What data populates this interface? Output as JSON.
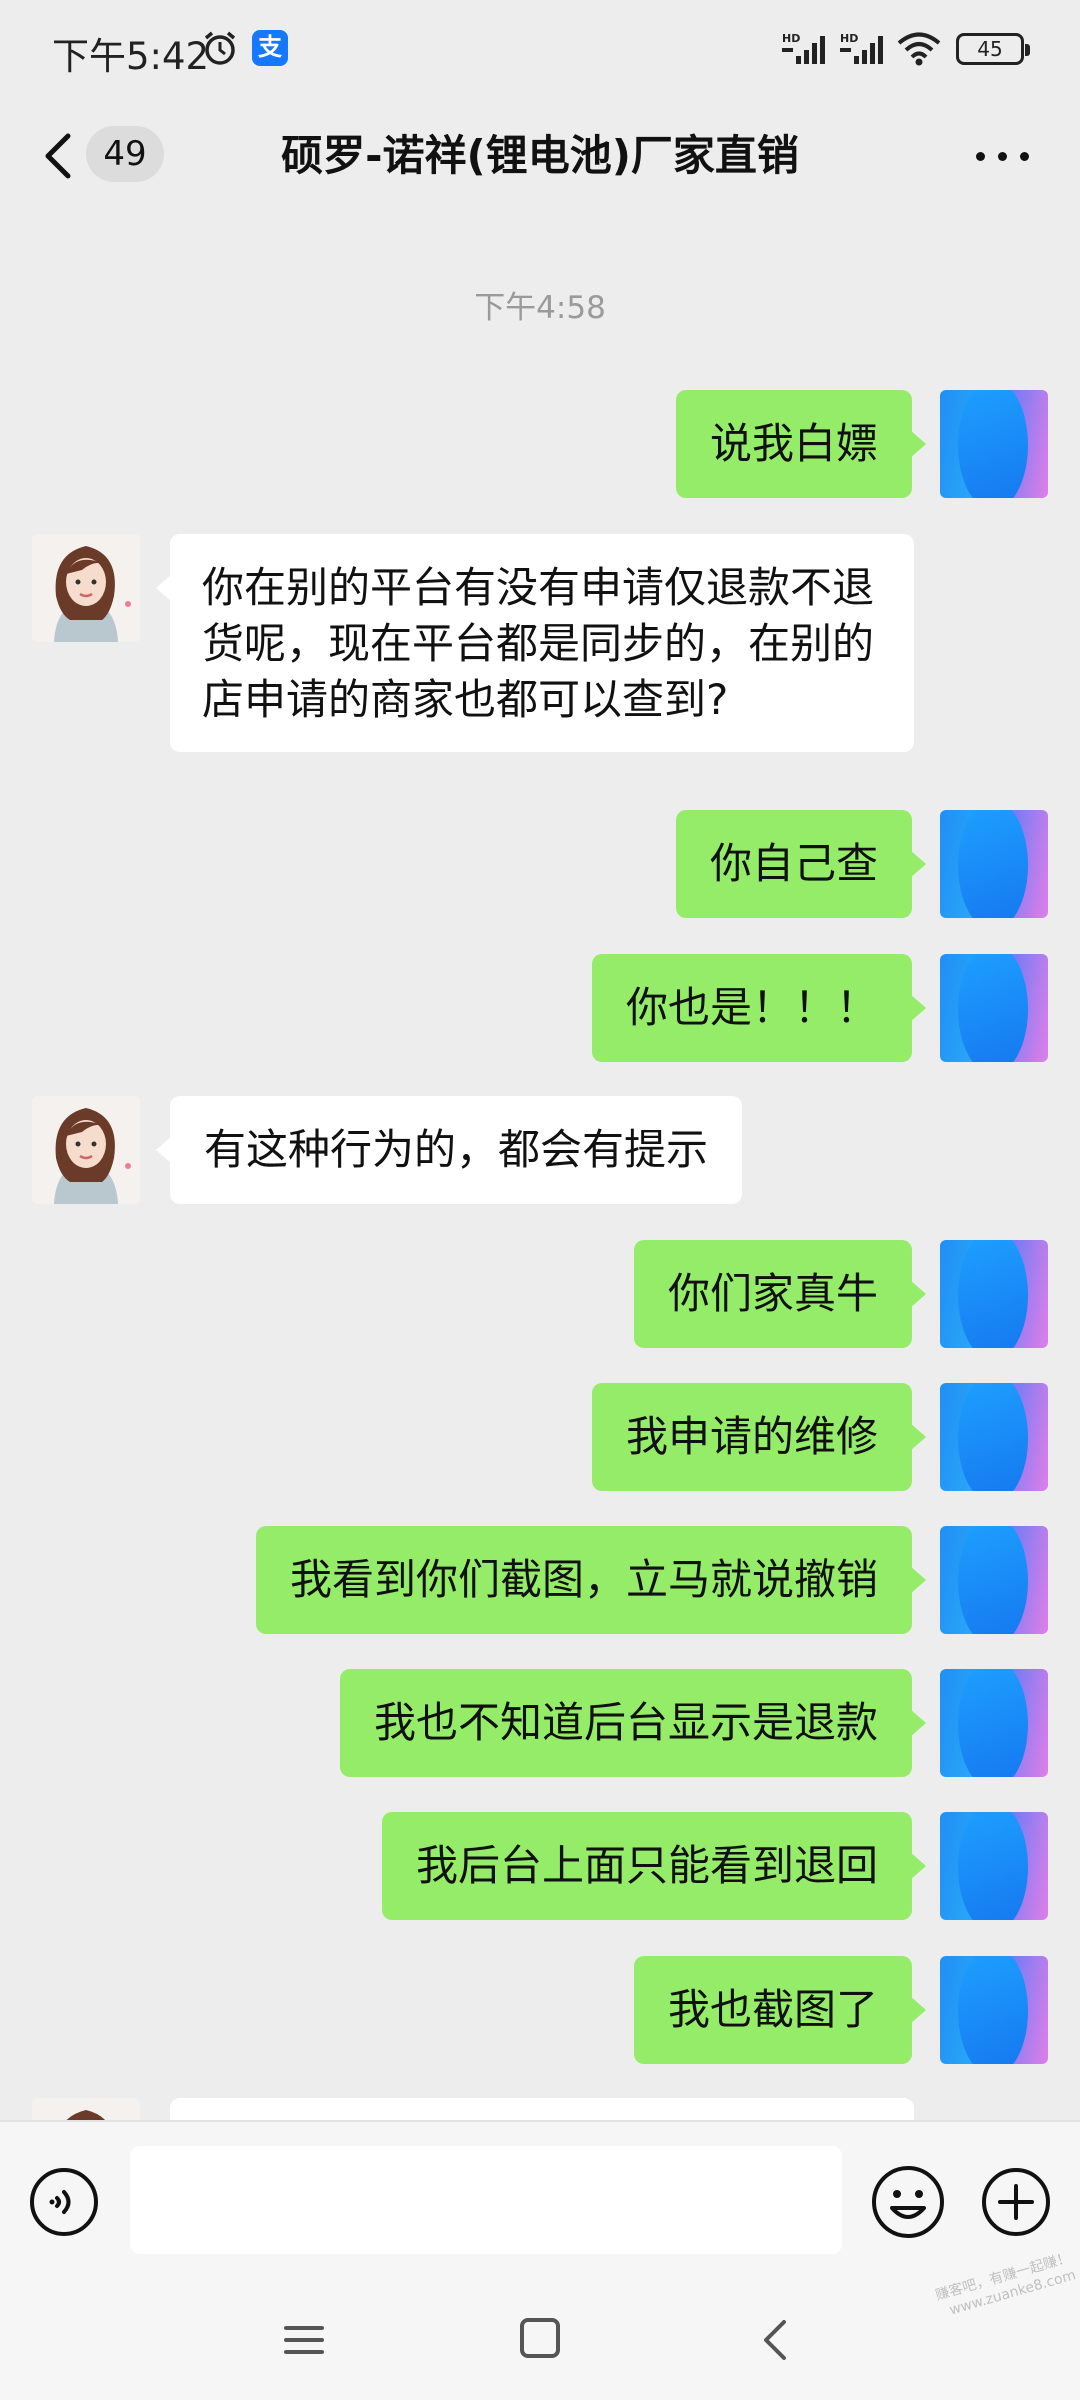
{
  "status_bar": {
    "time": "下午5:42",
    "alipay_icon_text": "支",
    "signal_1_label": "HD",
    "signal_2_label": "HD",
    "battery": "45"
  },
  "header": {
    "unread_count": "49",
    "title": "硕罗-诺祥(锂电池)厂家直销"
  },
  "chat": {
    "timestamp": "下午4:58",
    "messages": [
      {
        "side": "right",
        "text": "说我白嫖"
      },
      {
        "side": "left",
        "text": "你在别的平台有没有申请仅退款不退货呢，现在平台都是同步的，在别的店申请的商家也都可以查到?"
      },
      {
        "side": "right",
        "text": "你自己查"
      },
      {
        "side": "right",
        "text": "你也是！！！"
      },
      {
        "side": "left",
        "text": "有这种行为的，都会有提示"
      },
      {
        "side": "right",
        "text": "你们家真牛"
      },
      {
        "side": "right",
        "text": "我申请的维修"
      },
      {
        "side": "right",
        "text": "我看到你们截图，立马就说撤销"
      },
      {
        "side": "right",
        "text": "我也不知道后台显示是退款"
      },
      {
        "side": "right",
        "text": "我后台上面只能看到退回"
      },
      {
        "side": "right",
        "text": "我也截图了"
      }
    ]
  },
  "input_bar": {
    "value": "",
    "icons": [
      "voice-icon",
      "emoji-icon",
      "plus-icon"
    ]
  },
  "nav_bar": {
    "icons": [
      "menu-icon",
      "home-icon",
      "back-icon"
    ]
  },
  "watermark": {
    "line1": "赚客吧，有赚一起赚！",
    "line2": "www.zuanke8.com"
  },
  "colors": {
    "outgoing_bubble": "#95ec69",
    "incoming_bubble": "#ffffff",
    "background": "#ededed"
  }
}
